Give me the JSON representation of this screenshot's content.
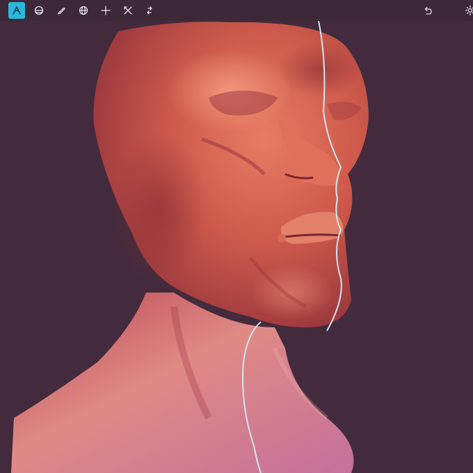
{
  "app": {
    "background_color": "#432b3d",
    "toolbar_color": "#3d2838",
    "accent_color": "#29b8dc",
    "model_base_color": "#c8524a"
  },
  "toolbar": {
    "tools": [
      {
        "icon": "sculpt-tool-icon",
        "active": true
      },
      {
        "icon": "material-sphere-icon",
        "active": false
      },
      {
        "icon": "pencil-icon",
        "active": false
      },
      {
        "icon": "globe-icon",
        "active": false
      },
      {
        "icon": "transform-sparkle-icon",
        "active": false
      },
      {
        "icon": "symmetry-icon",
        "active": false
      },
      {
        "icon": "swap-arrows-icon",
        "active": false
      }
    ],
    "right": [
      {
        "icon": "undo-icon"
      },
      {
        "icon": "settings-gear-icon"
      }
    ]
  },
  "viewport": {
    "object": "sculpted-head-bust",
    "symmetry_line_color": "#cfe8ec"
  }
}
